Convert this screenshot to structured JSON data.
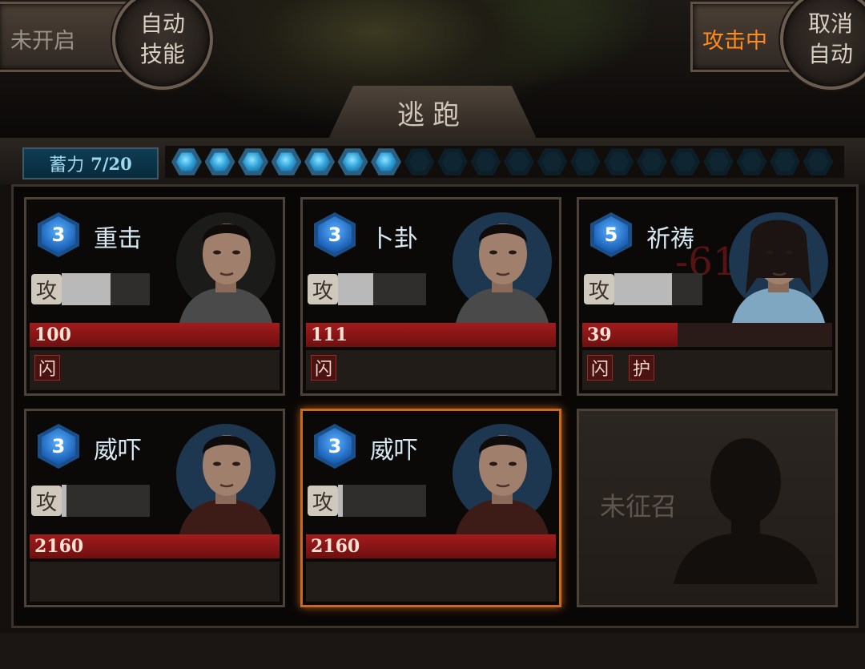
{
  "top": {
    "status_left": "未开启",
    "auto_skill_label": "自动\n技能",
    "status_right": "攻击中",
    "cancel_auto_label": "取消\n自动",
    "flee_label": "逃跑"
  },
  "charge": {
    "label": "蓄力",
    "value": "7/20",
    "current": 7,
    "max": 20
  },
  "cards": [
    {
      "level": "3",
      "skill": "重击",
      "attack_tag": "攻",
      "attack_fill": 0.55,
      "hp": "100",
      "hp_fill": 1.0,
      "tags": [
        "闪"
      ],
      "selected": false,
      "portrait": "man-1"
    },
    {
      "level": "3",
      "skill": "卜卦",
      "attack_tag": "攻",
      "attack_fill": 0.4,
      "hp": "111",
      "hp_fill": 1.0,
      "tags": [
        "闪"
      ],
      "selected": false,
      "portrait": "man-2"
    },
    {
      "level": "5",
      "skill": "祈祷",
      "attack_tag": "攻",
      "attack_fill": 0.65,
      "hp": "39",
      "hp_fill": 0.38,
      "tags": [
        "闪",
        "护"
      ],
      "selected": false,
      "portrait": "woman-1",
      "damage_text": "-61"
    },
    {
      "level": "3",
      "skill": "威吓",
      "attack_tag": "攻",
      "attack_fill": 0.05,
      "hp": "2160",
      "hp_fill": 1.0,
      "tags": [],
      "selected": false,
      "portrait": "man-3"
    },
    {
      "level": "3",
      "skill": "威吓",
      "attack_tag": "攻",
      "attack_fill": 0.05,
      "hp": "2160",
      "hp_fill": 1.0,
      "tags": [],
      "selected": true,
      "portrait": "man-3"
    }
  ],
  "empty_slot": {
    "label": "未征召"
  },
  "colors": {
    "accent": "#ff8a1e",
    "hp": "#a21c1c",
    "charge": "#2f9fd8"
  }
}
